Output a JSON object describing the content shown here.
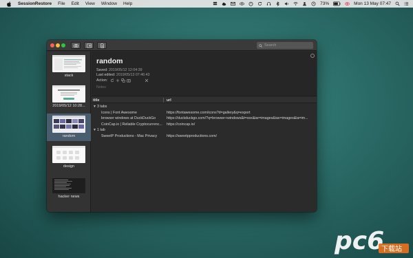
{
  "menubar": {
    "app_name": "SessionRestore",
    "menus": [
      "File",
      "Edit",
      "View",
      "Window",
      "Help"
    ],
    "battery": "73%",
    "datetime": "Mon 13 May  07:47"
  },
  "search": {
    "placeholder": "Search"
  },
  "sidebar": {
    "items": [
      {
        "label": "stack",
        "thumb": "stack-thumb"
      },
      {
        "label": "2019/05/12 10:28...",
        "thumb": "session-thumb"
      },
      {
        "label": "random",
        "thumb": "random-thumb",
        "selected": true
      },
      {
        "label": "design",
        "thumb": "design-thumb"
      },
      {
        "label": "hacker news",
        "thumb": "hacker-news-thumb"
      }
    ]
  },
  "detail": {
    "title": "random",
    "saved_label": "Saved:",
    "saved_value": "2019/05/12 12:04:39",
    "edited_label": "Last edited:",
    "edited_value": "2019/05/13 07:46:43",
    "action_label": "Action:",
    "notes_placeholder": "Notes"
  },
  "table": {
    "columns": {
      "title": "title",
      "url": "url"
    },
    "rows": [
      {
        "kind": "group",
        "title": "3 tabs",
        "url": ""
      },
      {
        "kind": "tab",
        "title": "Icons | Font Awesome",
        "url": "https://fontawesome.com/icons?d=gallery&q=export"
      },
      {
        "kind": "tab",
        "title": "browser windows at DuckDuckGo",
        "url": "https://duckduckgo.com/?q=browser+windows&t=osx&iar=images&iax=images&ia=im..."
      },
      {
        "kind": "tab",
        "title": "CoinCap.io | Reliable Cryptocurrenc...",
        "url": "https://coincap.io/"
      },
      {
        "kind": "group",
        "title": "1 tab",
        "url": ""
      },
      {
        "kind": "tab",
        "title": "SweetP Productions - Mac Privacy",
        "url": "https://sweetpproductions.com/"
      }
    ]
  },
  "watermark": {
    "text": "pc6",
    "sub": "下载站"
  },
  "colors": {
    "selection": "#4a5d6e",
    "desktop": "#2a6a66"
  }
}
